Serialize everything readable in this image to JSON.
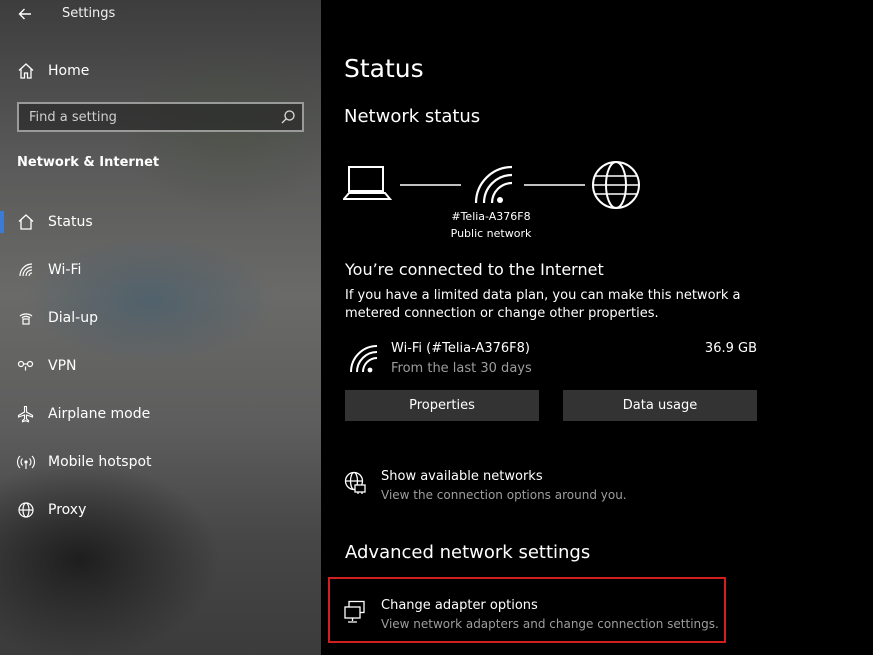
{
  "window": {
    "title": "Settings"
  },
  "sidebar": {
    "home_label": "Home",
    "search": {
      "placeholder": "Find a setting"
    },
    "section": "Network & Internet",
    "items": [
      {
        "label": "Status",
        "icon": "home-status-icon",
        "active": true
      },
      {
        "label": "Wi-Fi",
        "icon": "wifi-icon"
      },
      {
        "label": "Dial-up",
        "icon": "dialup-icon"
      },
      {
        "label": "VPN",
        "icon": "vpn-icon"
      },
      {
        "label": "Airplane mode",
        "icon": "airplane-icon"
      },
      {
        "label": "Mobile hotspot",
        "icon": "hotspot-icon"
      },
      {
        "label": "Proxy",
        "icon": "globe-icon"
      }
    ],
    "active_color": "#3a7bd5"
  },
  "main": {
    "title": "Status",
    "network_status_heading": "Network status",
    "network_name": "#Telia-A376F8",
    "network_type": "Public network",
    "connected_heading": "You’re connected to the Internet",
    "connected_desc": "If you have a limited data plan, you can make this network a metered connection or change other properties.",
    "connection": {
      "name": "Wi-Fi (#Telia-A376F8)",
      "period": "From the last 30 days",
      "usage": "36.9 GB"
    },
    "buttons": {
      "properties": "Properties",
      "data_usage": "Data usage"
    },
    "show_networks": {
      "title": "Show available networks",
      "subtitle": "View the connection options around you."
    },
    "advanced_heading": "Advanced network settings",
    "adapter_options": {
      "title": "Change adapter options",
      "subtitle": "View network adapters and change connection settings."
    },
    "highlight_color": "#d11f1f"
  }
}
